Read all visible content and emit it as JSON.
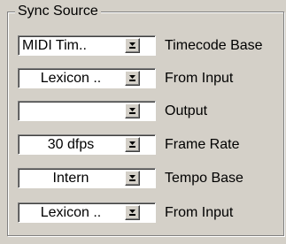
{
  "group": {
    "title": "Sync Source"
  },
  "rows": [
    {
      "value": "MIDI Tim..",
      "label": "Timecode Base",
      "button_icon": "dropdown-arrow-icon"
    },
    {
      "value": "Lexicon ..",
      "label": "From Input",
      "button_icon": "dropdown-arrow-icon"
    },
    {
      "value": "",
      "label": "Output",
      "button_icon": "dropdown-arrow-icon"
    },
    {
      "value": "30 dfps",
      "label": "Frame Rate",
      "button_icon": "dropdown-arrow-icon"
    },
    {
      "value": "Intern",
      "label": "Tempo Base",
      "button_icon": "dropdown-arrow-icon"
    },
    {
      "value": "Lexicon ..",
      "label": "From Input",
      "button_icon": "dropdown-arrow-icon"
    }
  ],
  "colors": {
    "face": "#d4d0c8",
    "field": "#ffffff",
    "shadow": "#808080",
    "highlight": "#ffffff",
    "text": "#000000"
  }
}
